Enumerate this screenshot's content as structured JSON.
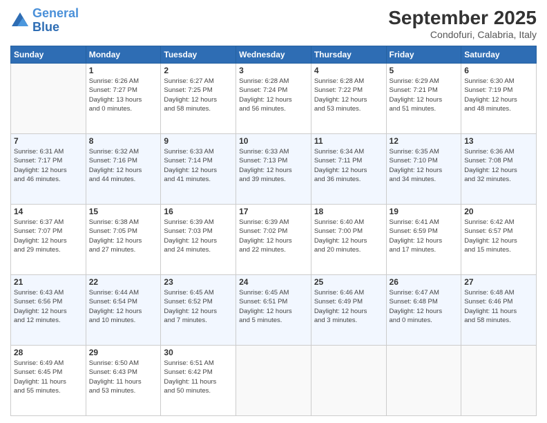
{
  "header": {
    "logo_line1": "General",
    "logo_line2": "Blue",
    "month_title": "September 2025",
    "location": "Condofuri, Calabria, Italy"
  },
  "days_of_week": [
    "Sunday",
    "Monday",
    "Tuesday",
    "Wednesday",
    "Thursday",
    "Friday",
    "Saturday"
  ],
  "weeks": [
    [
      {
        "day": "",
        "info": ""
      },
      {
        "day": "1",
        "info": "Sunrise: 6:26 AM\nSunset: 7:27 PM\nDaylight: 13 hours\nand 0 minutes."
      },
      {
        "day": "2",
        "info": "Sunrise: 6:27 AM\nSunset: 7:25 PM\nDaylight: 12 hours\nand 58 minutes."
      },
      {
        "day": "3",
        "info": "Sunrise: 6:28 AM\nSunset: 7:24 PM\nDaylight: 12 hours\nand 56 minutes."
      },
      {
        "day": "4",
        "info": "Sunrise: 6:28 AM\nSunset: 7:22 PM\nDaylight: 12 hours\nand 53 minutes."
      },
      {
        "day": "5",
        "info": "Sunrise: 6:29 AM\nSunset: 7:21 PM\nDaylight: 12 hours\nand 51 minutes."
      },
      {
        "day": "6",
        "info": "Sunrise: 6:30 AM\nSunset: 7:19 PM\nDaylight: 12 hours\nand 48 minutes."
      }
    ],
    [
      {
        "day": "7",
        "info": "Sunrise: 6:31 AM\nSunset: 7:17 PM\nDaylight: 12 hours\nand 46 minutes."
      },
      {
        "day": "8",
        "info": "Sunrise: 6:32 AM\nSunset: 7:16 PM\nDaylight: 12 hours\nand 44 minutes."
      },
      {
        "day": "9",
        "info": "Sunrise: 6:33 AM\nSunset: 7:14 PM\nDaylight: 12 hours\nand 41 minutes."
      },
      {
        "day": "10",
        "info": "Sunrise: 6:33 AM\nSunset: 7:13 PM\nDaylight: 12 hours\nand 39 minutes."
      },
      {
        "day": "11",
        "info": "Sunrise: 6:34 AM\nSunset: 7:11 PM\nDaylight: 12 hours\nand 36 minutes."
      },
      {
        "day": "12",
        "info": "Sunrise: 6:35 AM\nSunset: 7:10 PM\nDaylight: 12 hours\nand 34 minutes."
      },
      {
        "day": "13",
        "info": "Sunrise: 6:36 AM\nSunset: 7:08 PM\nDaylight: 12 hours\nand 32 minutes."
      }
    ],
    [
      {
        "day": "14",
        "info": "Sunrise: 6:37 AM\nSunset: 7:07 PM\nDaylight: 12 hours\nand 29 minutes."
      },
      {
        "day": "15",
        "info": "Sunrise: 6:38 AM\nSunset: 7:05 PM\nDaylight: 12 hours\nand 27 minutes."
      },
      {
        "day": "16",
        "info": "Sunrise: 6:39 AM\nSunset: 7:03 PM\nDaylight: 12 hours\nand 24 minutes."
      },
      {
        "day": "17",
        "info": "Sunrise: 6:39 AM\nSunset: 7:02 PM\nDaylight: 12 hours\nand 22 minutes."
      },
      {
        "day": "18",
        "info": "Sunrise: 6:40 AM\nSunset: 7:00 PM\nDaylight: 12 hours\nand 20 minutes."
      },
      {
        "day": "19",
        "info": "Sunrise: 6:41 AM\nSunset: 6:59 PM\nDaylight: 12 hours\nand 17 minutes."
      },
      {
        "day": "20",
        "info": "Sunrise: 6:42 AM\nSunset: 6:57 PM\nDaylight: 12 hours\nand 15 minutes."
      }
    ],
    [
      {
        "day": "21",
        "info": "Sunrise: 6:43 AM\nSunset: 6:56 PM\nDaylight: 12 hours\nand 12 minutes."
      },
      {
        "day": "22",
        "info": "Sunrise: 6:44 AM\nSunset: 6:54 PM\nDaylight: 12 hours\nand 10 minutes."
      },
      {
        "day": "23",
        "info": "Sunrise: 6:45 AM\nSunset: 6:52 PM\nDaylight: 12 hours\nand 7 minutes."
      },
      {
        "day": "24",
        "info": "Sunrise: 6:45 AM\nSunset: 6:51 PM\nDaylight: 12 hours\nand 5 minutes."
      },
      {
        "day": "25",
        "info": "Sunrise: 6:46 AM\nSunset: 6:49 PM\nDaylight: 12 hours\nand 3 minutes."
      },
      {
        "day": "26",
        "info": "Sunrise: 6:47 AM\nSunset: 6:48 PM\nDaylight: 12 hours\nand 0 minutes."
      },
      {
        "day": "27",
        "info": "Sunrise: 6:48 AM\nSunset: 6:46 PM\nDaylight: 11 hours\nand 58 minutes."
      }
    ],
    [
      {
        "day": "28",
        "info": "Sunrise: 6:49 AM\nSunset: 6:45 PM\nDaylight: 11 hours\nand 55 minutes."
      },
      {
        "day": "29",
        "info": "Sunrise: 6:50 AM\nSunset: 6:43 PM\nDaylight: 11 hours\nand 53 minutes."
      },
      {
        "day": "30",
        "info": "Sunrise: 6:51 AM\nSunset: 6:42 PM\nDaylight: 11 hours\nand 50 minutes."
      },
      {
        "day": "",
        "info": ""
      },
      {
        "day": "",
        "info": ""
      },
      {
        "day": "",
        "info": ""
      },
      {
        "day": "",
        "info": ""
      }
    ]
  ]
}
